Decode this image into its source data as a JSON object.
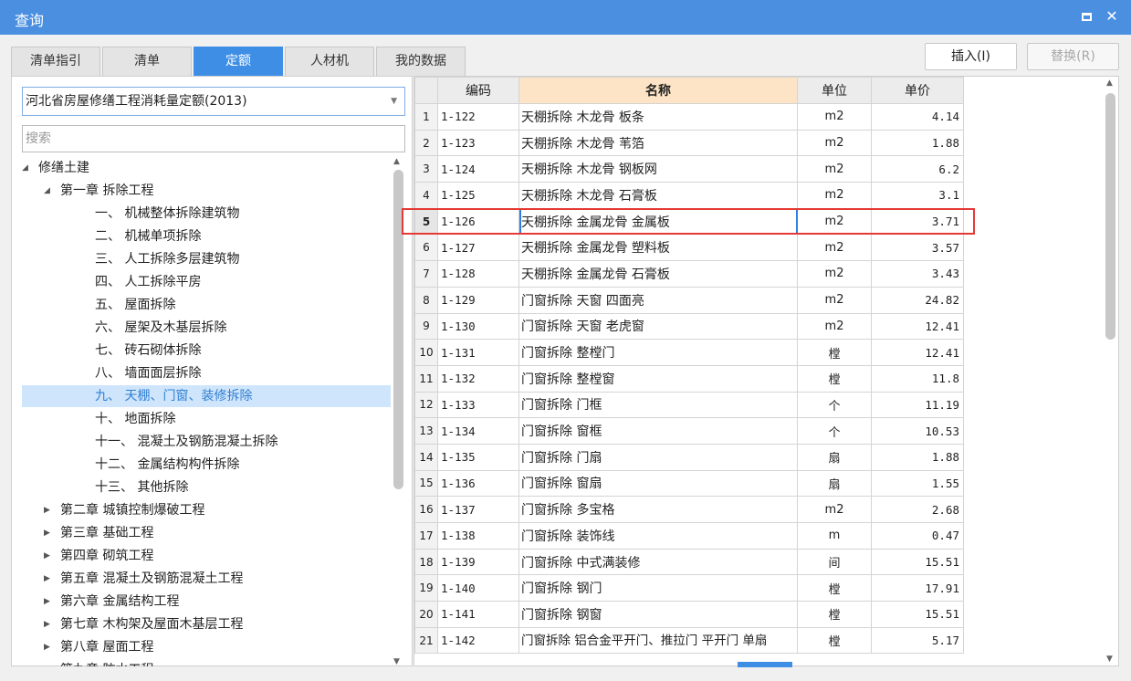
{
  "window": {
    "title": "查询"
  },
  "tabs": [
    "清单指引",
    "清单",
    "定额",
    "人材机",
    "我的数据"
  ],
  "active_tab": 2,
  "buttons": {
    "insert": "插入(I)",
    "replace": "替换(R)"
  },
  "left": {
    "library": "河北省房屋修缮工程消耗量定额(2013)",
    "search_placeholder": "搜索",
    "tree": [
      {
        "label": "修缮土建",
        "level": 0,
        "toggle": "◢"
      },
      {
        "label": "第一章 拆除工程",
        "level": 1,
        "toggle": "◢"
      },
      {
        "label": "一、 机械整体拆除建筑物",
        "level": 2,
        "toggle": ""
      },
      {
        "label": "二、 机械单项拆除",
        "level": 2,
        "toggle": ""
      },
      {
        "label": "三、 人工拆除多层建筑物",
        "level": 2,
        "toggle": ""
      },
      {
        "label": "四、 人工拆除平房",
        "level": 2,
        "toggle": ""
      },
      {
        "label": "五、 屋面拆除",
        "level": 2,
        "toggle": ""
      },
      {
        "label": "六、 屋架及木基层拆除",
        "level": 2,
        "toggle": ""
      },
      {
        "label": "七、 砖石砌体拆除",
        "level": 2,
        "toggle": ""
      },
      {
        "label": "八、 墙面面层拆除",
        "level": 2,
        "toggle": ""
      },
      {
        "label": "九、 天棚、门窗、装修拆除",
        "level": 2,
        "toggle": "",
        "selected": true
      },
      {
        "label": "十、 地面拆除",
        "level": 2,
        "toggle": ""
      },
      {
        "label": "十一、 混凝土及钢筋混凝土拆除",
        "level": 2,
        "toggle": ""
      },
      {
        "label": "十二、 金属结构构件拆除",
        "level": 2,
        "toggle": ""
      },
      {
        "label": "十三、 其他拆除",
        "level": 2,
        "toggle": ""
      },
      {
        "label": "第二章 城镇控制爆破工程",
        "level": 1,
        "toggle": "▶"
      },
      {
        "label": "第三章 基础工程",
        "level": 1,
        "toggle": "▶"
      },
      {
        "label": "第四章 砌筑工程",
        "level": 1,
        "toggle": "▶"
      },
      {
        "label": "第五章 混凝土及钢筋混凝土工程",
        "level": 1,
        "toggle": "▶"
      },
      {
        "label": "第六章 金属结构工程",
        "level": 1,
        "toggle": "▶"
      },
      {
        "label": "第七章 木构架及屋面木基层工程",
        "level": 1,
        "toggle": "▶"
      },
      {
        "label": "第八章 屋面工程",
        "level": 1,
        "toggle": "▶"
      },
      {
        "label": "第九章 防水工程",
        "level": 1,
        "toggle": "▶"
      }
    ]
  },
  "table": {
    "headers": [
      "",
      "编码",
      "名称",
      "单位",
      "单价"
    ],
    "rows": [
      [
        "1",
        "1-122",
        "天棚拆除 木龙骨 板条",
        "m2",
        "4.14"
      ],
      [
        "2",
        "1-123",
        "天棚拆除 木龙骨 苇箔",
        "m2",
        "1.88"
      ],
      [
        "3",
        "1-124",
        "天棚拆除 木龙骨 钢板网",
        "m2",
        "6.2"
      ],
      [
        "4",
        "1-125",
        "天棚拆除 木龙骨 石膏板",
        "m2",
        "3.1"
      ],
      [
        "5",
        "1-126",
        "天棚拆除 金属龙骨 金属板",
        "m2",
        "3.71"
      ],
      [
        "6",
        "1-127",
        "天棚拆除 金属龙骨 塑料板",
        "m2",
        "3.57"
      ],
      [
        "7",
        "1-128",
        "天棚拆除 金属龙骨 石膏板",
        "m2",
        "3.43"
      ],
      [
        "8",
        "1-129",
        "门窗拆除 天窗 四面亮",
        "m2",
        "24.82"
      ],
      [
        "9",
        "1-130",
        "门窗拆除 天窗 老虎窗",
        "m2",
        "12.41"
      ],
      [
        "10",
        "1-131",
        "门窗拆除 整樘门",
        "樘",
        "12.41"
      ],
      [
        "11",
        "1-132",
        "门窗拆除 整樘窗",
        "樘",
        "11.8"
      ],
      [
        "12",
        "1-133",
        "门窗拆除 门框",
        "个",
        "11.19"
      ],
      [
        "13",
        "1-134",
        "门窗拆除 窗框",
        "个",
        "10.53"
      ],
      [
        "14",
        "1-135",
        "门窗拆除 门扇",
        "扇",
        "1.88"
      ],
      [
        "15",
        "1-136",
        "门窗拆除 窗扇",
        "扇",
        "1.55"
      ],
      [
        "16",
        "1-137",
        "门窗拆除 多宝格",
        "m2",
        "2.68"
      ],
      [
        "17",
        "1-138",
        "门窗拆除 装饰线",
        "m",
        "0.47"
      ],
      [
        "18",
        "1-139",
        "门窗拆除 中式满装修",
        "间",
        "15.51"
      ],
      [
        "19",
        "1-140",
        "门窗拆除 钢门",
        "樘",
        "17.91"
      ],
      [
        "20",
        "1-141",
        "门窗拆除 钢窗",
        "樘",
        "15.51"
      ],
      [
        "21",
        "1-142",
        "门窗拆除 铝合金平开门、推拉门 平开门 单扇",
        "樘",
        "5.17"
      ]
    ],
    "selected_row": 4
  }
}
